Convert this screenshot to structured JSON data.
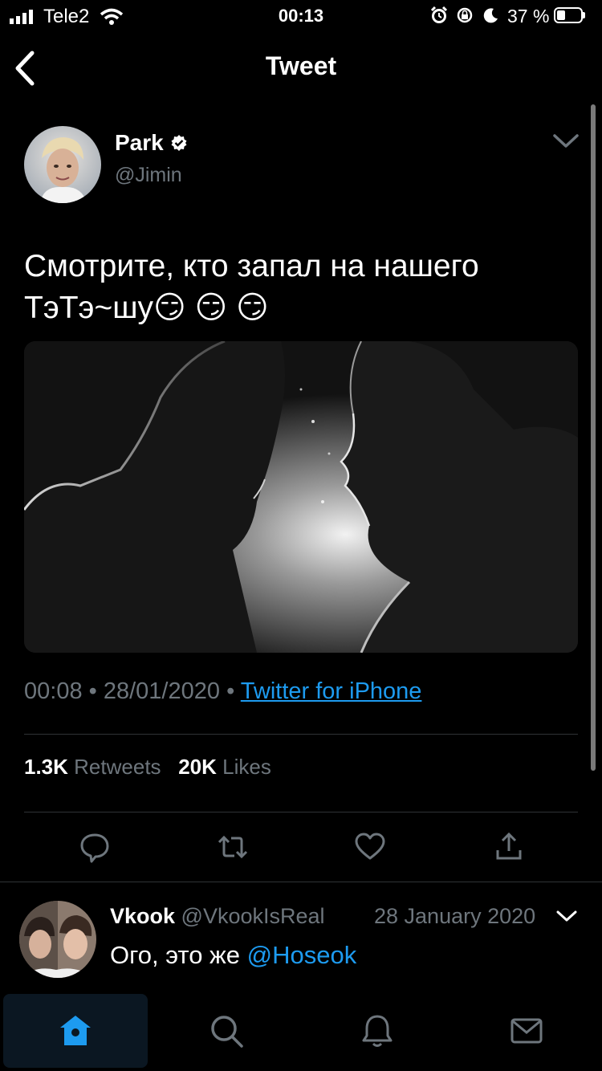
{
  "status_bar": {
    "carrier": "Tele2",
    "time": "00:13",
    "battery_percent": "37 %",
    "battery_level": 0.37
  },
  "header": {
    "title": "Tweet"
  },
  "tweet": {
    "author_name": "Park",
    "author_handle": "@Jimin",
    "text": "Смотрите, кто запал на нашего ТэТэ~шу😏 😏 😏",
    "time": "00:08",
    "date": "28/01/2020",
    "separator": "•",
    "source": "Twitter for iPhone",
    "retweets_count": "1.3K",
    "retweets_label": "Retweets",
    "likes_count": "20K",
    "likes_label": "Likes"
  },
  "reply": {
    "name": "Vkook",
    "handle": "@VkookIsReal",
    "date": "28 January 2020",
    "text": "Ого, это же ",
    "mention": "@Hoseok"
  },
  "icons": {
    "back": "chevron-left-icon",
    "verified": "verified-badge-icon",
    "reply": "reply-icon",
    "retweet": "retweet-icon",
    "like": "heart-icon",
    "share": "share-icon",
    "home": "home-icon",
    "search": "search-icon",
    "notifications": "bell-icon",
    "messages": "mail-icon"
  },
  "colors": {
    "accent": "#1d9bf0",
    "muted": "#6e767d",
    "background": "#000000"
  }
}
